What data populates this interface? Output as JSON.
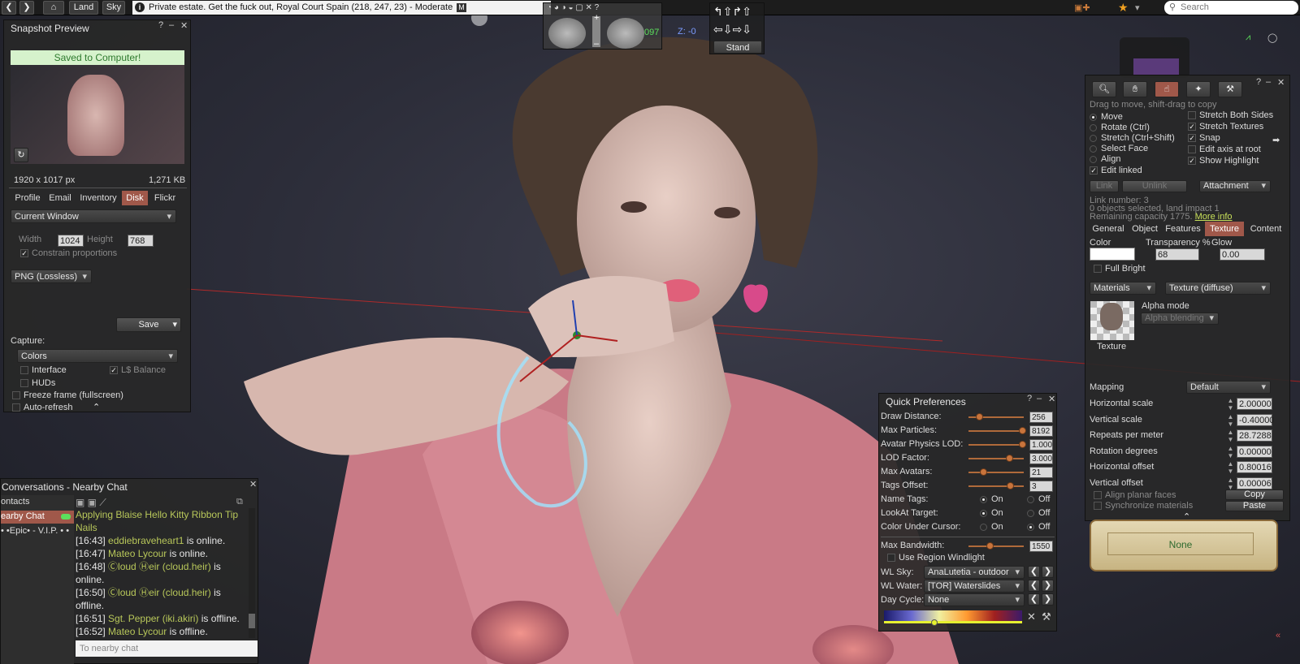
{
  "topbar": {
    "land_label": "Land",
    "sky_label": "Sky",
    "location": "Private estate. Get the fuck out, Royal Court Spain (218, 247, 23) - Moderate",
    "maturity_badge": "M",
    "search_placeholder": "Search"
  },
  "hud": {
    "coord_y": "097",
    "coord_z": "Z: -0",
    "stand_label": "Stand",
    "plus": "+",
    "minus": "–"
  },
  "snapshot": {
    "title": "Snapshot Preview",
    "saved_banner": "Saved to Computer!",
    "resolution": "1920 x 1017 px",
    "filesize": "1,271 KB",
    "tabs": [
      "Profile",
      "Email",
      "Inventory",
      "Disk",
      "Flickr"
    ],
    "active_tab": "Disk",
    "size_preset": "Current Window",
    "width_label": "Width",
    "width_value": "1024",
    "height_label": "Height",
    "height_value": "768",
    "constrain_label": "Constrain proportions",
    "format": "PNG (Lossless)",
    "save_label": "Save",
    "capture_label": "Capture:",
    "capture_mode": "Colors",
    "interface_label": "Interface",
    "balance_label": "L$ Balance",
    "huds_label": "HUDs",
    "freeze_label": "Freeze frame (fullscreen)",
    "autorefresh_label": "Auto-refresh"
  },
  "chat": {
    "title": "Conversations - Nearby Chat",
    "contacts_header": "ontacts",
    "list": [
      "earby Chat",
      "• •Epic• - V.I.P. • •"
    ],
    "lines": [
      {
        "time": "",
        "name": "",
        "text": "Applying Blaise Hello Kitty Ribbon Tip Nails"
      },
      {
        "time": "[16:43]",
        "name": "eddiebraveheart1",
        "text": " is online."
      },
      {
        "time": "[16:47]",
        "name": "Mateo Lycour",
        "text": " is online."
      },
      {
        "time": "[16:48]",
        "name": "Ⓒloud Ⓗeir (cloud.heir)",
        "text": " is online."
      },
      {
        "time": "[16:50]",
        "name": "Ⓒloud Ⓗeir (cloud.heir)",
        "text": " is offline."
      },
      {
        "time": "[16:51]",
        "name": "Sgt. Pepper (iki.akiri)",
        "text": " is offline."
      },
      {
        "time": "[16:52]",
        "name": "Mateo Lycour",
        "text": " is offline."
      }
    ],
    "input_placeholder": "To nearby chat"
  },
  "quickprefs": {
    "title": "Quick Preferences",
    "sliders": [
      {
        "label": "Draw Distance:",
        "value": "256",
        "pos": 0.2
      },
      {
        "label": "Max Particles:",
        "value": "8192",
        "pos": 1.0
      },
      {
        "label": "Avatar Physics LOD:",
        "value": "1.000",
        "pos": 1.0
      },
      {
        "label": "LOD Factor:",
        "value": "3.000",
        "pos": 0.75
      },
      {
        "label": "Max Avatars:",
        "value": "21",
        "pos": 0.28
      },
      {
        "label": "Tags Offset:",
        "value": "3",
        "pos": 0.78
      }
    ],
    "radios": [
      {
        "label": "Name Tags:",
        "on": "On",
        "off": "Off",
        "selected": "On"
      },
      {
        "label": "LookAt Target:",
        "on": "On",
        "off": "Off",
        "selected": "On"
      },
      {
        "label": "Color Under Cursor:",
        "on": "On",
        "off": "Off",
        "selected": "Off"
      }
    ],
    "bandwidth_label": "Max Bandwidth:",
    "bandwidth_value": "1550",
    "bandwidth_pos": 0.4,
    "windlight_label": "Use Region Windlight",
    "wlsky_label": "WL Sky:",
    "wlsky_value": "AnaLutetia - outdoor",
    "wlwater_label": "WL Water:",
    "wlwater_value": "[TOR] Waterslides",
    "daycycle_label": "Day Cycle:",
    "daycycle_value": "None",
    "daycycle_pos": 0.36
  },
  "build": {
    "hint": "Drag to move, shift-drag to copy",
    "modes": [
      "Move",
      "Rotate (Ctrl)",
      "Stretch (Ctrl+Shift)",
      "Select Face",
      "Align"
    ],
    "selected_mode": "Move",
    "edit_linked": "Edit linked",
    "right_opts": [
      {
        "label": "Stretch Both Sides",
        "checked": false
      },
      {
        "label": "Stretch Textures",
        "checked": true
      },
      {
        "label": "Snap",
        "checked": true
      },
      {
        "label": "Edit axis at root",
        "checked": false
      },
      {
        "label": "Show Highlight",
        "checked": true
      }
    ],
    "link_label": "Link",
    "unlink_label": "Unlink",
    "attachment_label": "Attachment",
    "link_number": "Link number: 3",
    "objects_selected": "0 objects selected, land impact 1",
    "remaining": "Remaining capacity 1775.",
    "more_info": "More info",
    "tabs": [
      "General",
      "Object",
      "Features",
      "Texture",
      "Content"
    ],
    "active_tab": "Texture",
    "color_label": "Color",
    "transparency_label": "Transparency %",
    "transparency_value": "68",
    "glow_label": "Glow",
    "glow_value": "0.00",
    "fullbright_label": "Full Bright",
    "materials_value": "Materials",
    "texture_type": "Texture (diffuse)",
    "alpha_mode_label": "Alpha mode",
    "alpha_mode_value": "Alpha blending",
    "texture_label": "Texture",
    "mapping_label": "Mapping",
    "mapping_value": "Default",
    "params": [
      {
        "label": "Horizontal scale",
        "value": "2.00000"
      },
      {
        "label": "Vertical scale",
        "value": "-0.40000"
      },
      {
        "label": "Repeats per meter",
        "value": "28.7288"
      },
      {
        "label": "Rotation degrees",
        "value": "0.00000"
      },
      {
        "label": "Horizontal offset",
        "value": "0.80016"
      },
      {
        "label": "Vertical offset",
        "value": "0.00006"
      }
    ],
    "align_planar": "Align planar faces",
    "sync_materials": "Synchronize materials",
    "copy_label": "Copy",
    "paste_label": "Paste"
  },
  "scroll_widget": {
    "value": "None"
  }
}
